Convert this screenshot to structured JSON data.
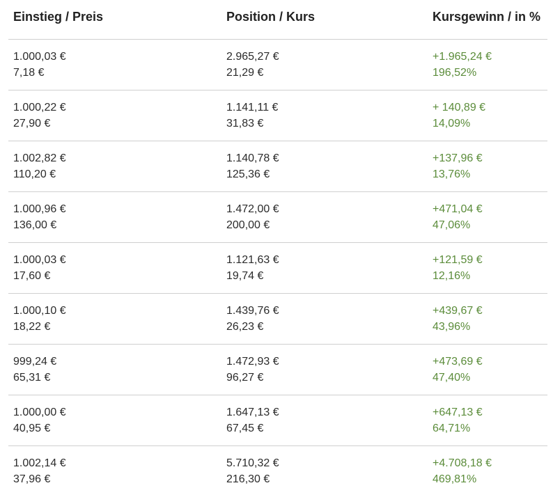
{
  "header": {
    "col1": "Einstieg / Preis",
    "col2": "Position / Kurs",
    "col3": "Kursgewinn / in %"
  },
  "rows": [
    {
      "einstieg": "1.000,03 €",
      "preis": "7,18 €",
      "position": "2.965,27 €",
      "kurs": "21,29 €",
      "gewinn": "+1.965,24 €",
      "prozent": "196,52%"
    },
    {
      "einstieg": "1.000,22 €",
      "preis": "27,90 €",
      "position": "1.141,11 €",
      "kurs": "31,83 €",
      "gewinn": "+ 140,89 €",
      "prozent": "14,09%"
    },
    {
      "einstieg": "1.002,82 €",
      "preis": "110,20 €",
      "position": "1.140,78 €",
      "kurs": "125,36 €",
      "gewinn": "+137,96 €",
      "prozent": "13,76%"
    },
    {
      "einstieg": "1.000,96 €",
      "preis": "136,00 €",
      "position": "1.472,00 €",
      "kurs": "200,00 €",
      "gewinn": "+471,04 €",
      "prozent": "47,06%"
    },
    {
      "einstieg": "1.000,03 €",
      "preis": "17,60 €",
      "position": "1.121,63 €",
      "kurs": "19,74 €",
      "gewinn": "+121,59 €",
      "prozent": "12,16%"
    },
    {
      "einstieg": "1.000,10 €",
      "preis": "18,22 €",
      "position": "1.439,76 €",
      "kurs": "26,23 €",
      "gewinn": "+439,67 €",
      "prozent": "43,96%"
    },
    {
      "einstieg": "999,24 €",
      "preis": "65,31 €",
      "position": "1.472,93 €",
      "kurs": "96,27 €",
      "gewinn": "+473,69 €",
      "prozent": "47,40%"
    },
    {
      "einstieg": "1.000,00 €",
      "preis": "40,95 €",
      "position": "1.647,13 €",
      "kurs": "67,45 €",
      "gewinn": "+647,13 €",
      "prozent": "64,71%"
    },
    {
      "einstieg": "1.002,14 €",
      "preis": "37,96 €",
      "position": "5.710,32 €",
      "kurs": "216,30 €",
      "gewinn": "+4.708,18 €",
      "prozent": "469,81%"
    }
  ],
  "colors": {
    "gain": "#5b8c3a",
    "divider": "#cfcfcf"
  }
}
